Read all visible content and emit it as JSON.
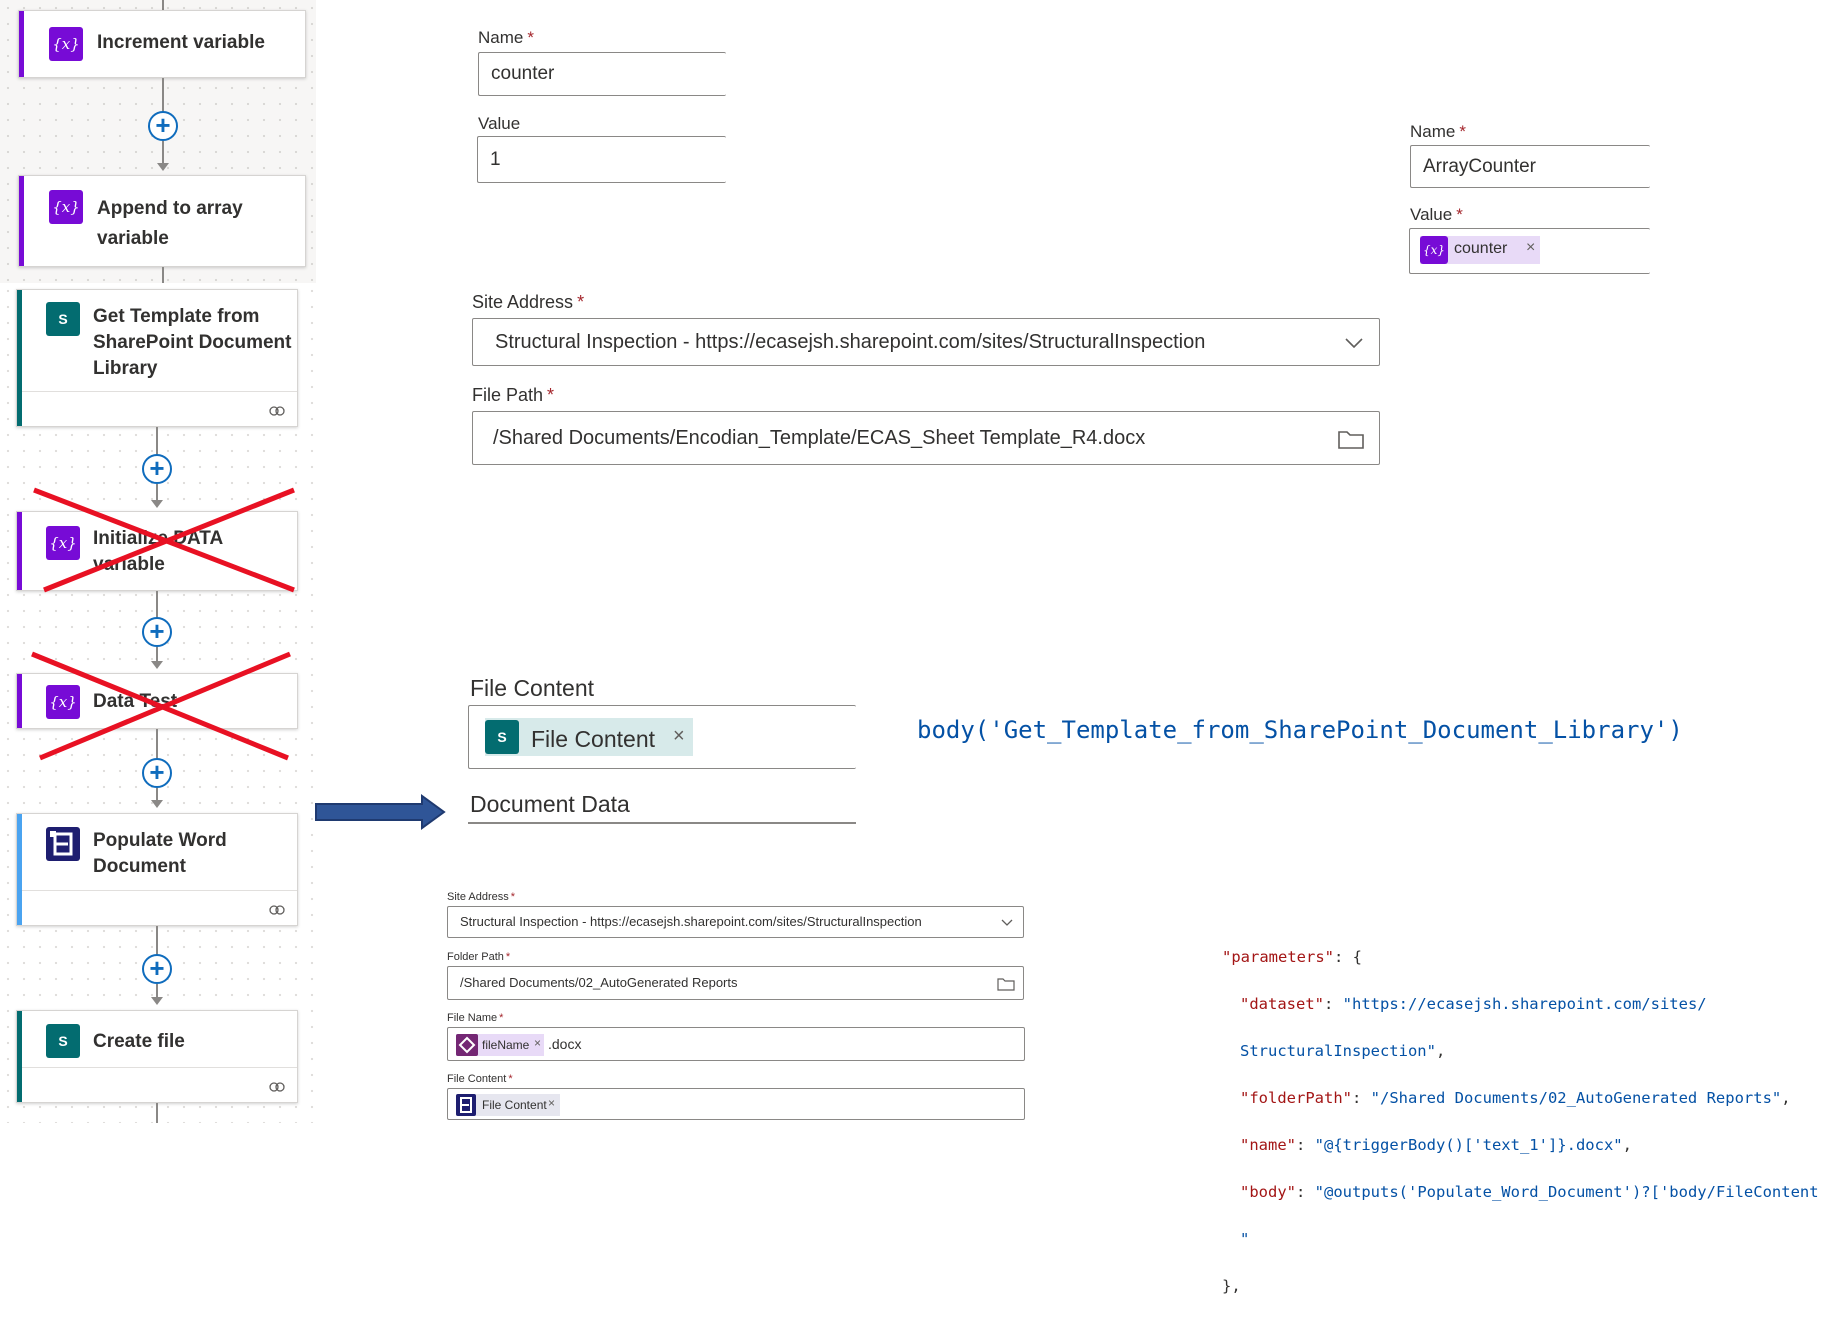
{
  "flow": {
    "steps": [
      {
        "title": "Increment variable",
        "icon": "variable-icon"
      },
      {
        "title": "Append to array variable",
        "icon": "variable-icon"
      },
      {
        "title": "Get Template from SharePoint Document Library",
        "icon": "sharepoint-icon"
      },
      {
        "title": "Initialize DATA variable",
        "icon": "variable-icon",
        "crossed_out": true
      },
      {
        "title": "Data Test",
        "icon": "variable-icon",
        "crossed_out": true
      },
      {
        "title": "Populate Word Document",
        "icon": "encodian-icon"
      },
      {
        "title": "Create file",
        "icon": "sharepoint-icon"
      }
    ],
    "variable_glyph": "{x}",
    "sharepoint_glyph": "S",
    "colors": {
      "variable": "#770bd6",
      "sharepoint": "#036c70",
      "encodian": "#1e1e70",
      "cross": "#e81123",
      "arrow": "#2f5597"
    }
  },
  "increment": {
    "name_label": "Name",
    "name_value": "counter",
    "value_label": "Value",
    "value_value": "1"
  },
  "append": {
    "name_label": "Name",
    "name_value": "ArrayCounter",
    "value_label": "Value",
    "value_token": "counter"
  },
  "get_template": {
    "site_label": "Site Address",
    "site_value": "Structural Inspection - https://ecasejsh.sharepoint.com/sites/StructuralInspection",
    "path_label": "File Path",
    "path_value": "/Shared Documents/Encodian_Template/ECAS_Sheet Template_R4.docx"
  },
  "populate": {
    "content_label": "File Content",
    "content_token": "File Content",
    "data_label": "Document Data",
    "expression": "body('Get_Template_from_SharePoint_Document_Library')"
  },
  "create_file": {
    "site_label": "Site Address",
    "site_value": "Structural Inspection - https://ecasejsh.sharepoint.com/sites/StructuralInspection",
    "folder_label": "Folder Path",
    "folder_value": "/Shared Documents/02_AutoGenerated Reports",
    "name_label": "File Name",
    "name_token": "fileName",
    "name_suffix": ".docx",
    "content_label": "File Content",
    "content_token": "File Content",
    "token_remove": "×",
    "required_mark": "*"
  },
  "json_code": {
    "line1_key": "\"parameters\"",
    "line1_rest": ": {",
    "dataset_key": "\"dataset\"",
    "dataset_val_a": "\"https://ecasejsh.sharepoint.com/sites/",
    "dataset_val_b": "StructuralInspection\"",
    "folder_key": "\"folderPath\"",
    "folder_val": "\"/Shared Documents/02_AutoGenerated Reports\"",
    "name_key": "\"name\"",
    "name_val": "\"@{triggerBody()['text_1']}.docx\"",
    "body_key": "\"body\"",
    "body_val": "\"@outputs('Populate_Word_Document')?['body/FileContent']",
    "quote_line": "\"",
    "close_line": "},"
  }
}
